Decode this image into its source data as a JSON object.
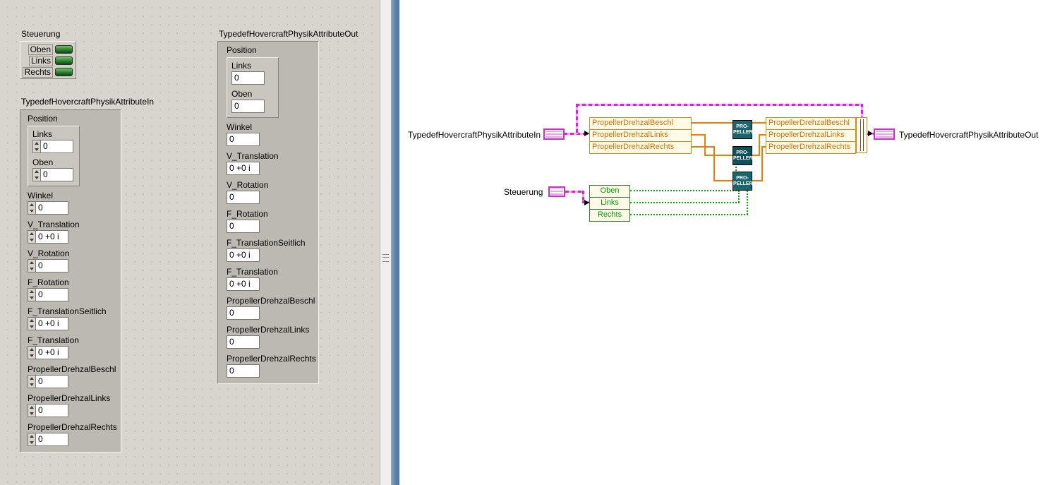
{
  "front_panel": {
    "steuerung": {
      "label": "Steuerung",
      "leds": [
        {
          "label": "Oben"
        },
        {
          "label": "Links"
        },
        {
          "label": "Rechts"
        }
      ],
      "led_color": "#2f8a2f"
    },
    "cluster_in": {
      "label": "TypedefHovercraftPhysikAttributeIn",
      "position_label": "Position",
      "position_fields": [
        {
          "label": "Links",
          "value": "0"
        },
        {
          "label": "Oben",
          "value": "0"
        }
      ],
      "fields": [
        {
          "label": "Winkel",
          "value": "0"
        },
        {
          "label": "V_Translation",
          "value": "0 +0 i"
        },
        {
          "label": "V_Rotation",
          "value": "0"
        },
        {
          "label": "F_Rotation",
          "value": "0"
        },
        {
          "label": "F_TranslationSeitlich",
          "value": "0 +0 i"
        },
        {
          "label": "F_Translation",
          "value": "0 +0 i"
        },
        {
          "label": "PropellerDrehzalBeschl",
          "value": "0"
        },
        {
          "label": "PropellerDrehzalLinks",
          "value": "0"
        },
        {
          "label": "PropellerDrehzalRechts",
          "value": "0"
        }
      ]
    },
    "cluster_out": {
      "label": "TypedefHovercraftPhysikAttributeOut",
      "position_label": "Position",
      "position_fields": [
        {
          "label": "Links",
          "value": "0"
        },
        {
          "label": "Oben",
          "value": "0"
        }
      ],
      "fields": [
        {
          "label": "Winkel",
          "value": "0"
        },
        {
          "label": "V_Translation",
          "value": "0 +0 i"
        },
        {
          "label": "V_Rotation",
          "value": "0"
        },
        {
          "label": "F_Rotation",
          "value": "0"
        },
        {
          "label": "F_TranslationSeitlich",
          "value": "0 +0 i"
        },
        {
          "label": "F_Translation",
          "value": "0 +0 i"
        },
        {
          "label": "PropellerDrehzalBeschl",
          "value": "0"
        },
        {
          "label": "PropellerDrehzalLinks",
          "value": "0"
        },
        {
          "label": "PropellerDrehzalRechts",
          "value": "0"
        }
      ]
    }
  },
  "diagram": {
    "input_terminal_label": "TypedefHovercraftPhysikAttributeIn",
    "steuerung_terminal_label": "Steuerung",
    "output_terminal_label": "TypedefHovercraftPhysikAttributeOut",
    "unbundle_rows": [
      "PropellerDrehzalBeschl",
      "PropellerDrehzalLinks",
      "PropellerDrehzalRechts"
    ],
    "bundle_rows": [
      "PropellerDrehzalBeschl",
      "PropellerDrehzalLinks",
      "PropellerDrehzalRechts"
    ],
    "steuerung_rows": [
      "Oben",
      "Links",
      "Rechts"
    ],
    "subvi_label_line1": "PRO-",
    "subvi_label_line2": "PELLER",
    "colors": {
      "cluster_wire": "#e01ee0",
      "numeric_wire": "#ef7d00",
      "boolean_wire": "#00ad00",
      "subvi_background": "#19666c"
    }
  }
}
